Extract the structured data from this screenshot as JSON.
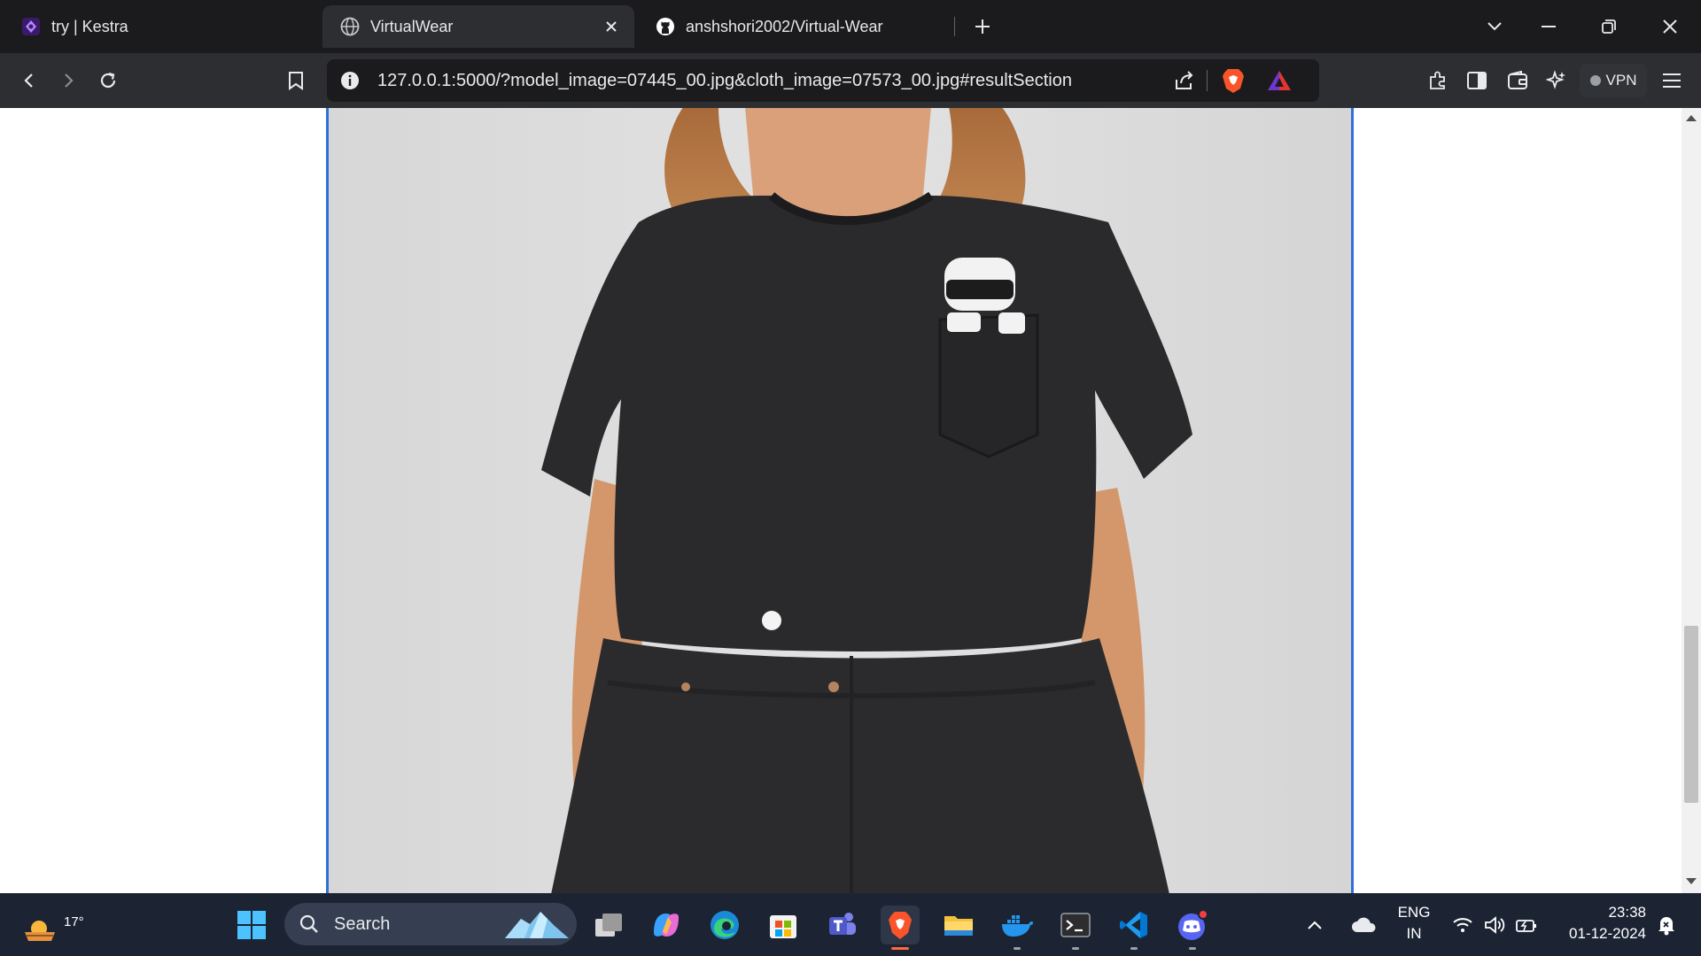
{
  "browser": {
    "tabs": [
      {
        "title": "try | Kestra",
        "favicon": "kestra-icon",
        "active": false
      },
      {
        "title": "VirtualWear",
        "favicon": "globe-icon",
        "active": true
      },
      {
        "title": "anshshori2002/Virtual-Wear",
        "favicon": "github-icon",
        "active": false
      }
    ],
    "url": "127.0.0.1:5000/?model_image=07445_00.jpg&cloth_image=07573_00.jpg#resultSection",
    "vpn_label": "VPN"
  },
  "page": {
    "result_image": {
      "subject": "model wearing black t-shirt with cartoon pocket print and black jeans",
      "frame_color": "#2f6fd6",
      "background_color": "#dcdcdc"
    }
  },
  "taskbar": {
    "weather_temp": "17°",
    "search_placeholder": "Search",
    "lang_top": "ENG",
    "lang_bottom": "IN",
    "time": "23:38",
    "date": "01-12-2024"
  },
  "colors": {
    "tab_bg": "#1b1b1d",
    "toolbar_bg": "#2d2e31",
    "taskbar_bg": "#1c2434",
    "brave_orange": "#fb542b"
  }
}
